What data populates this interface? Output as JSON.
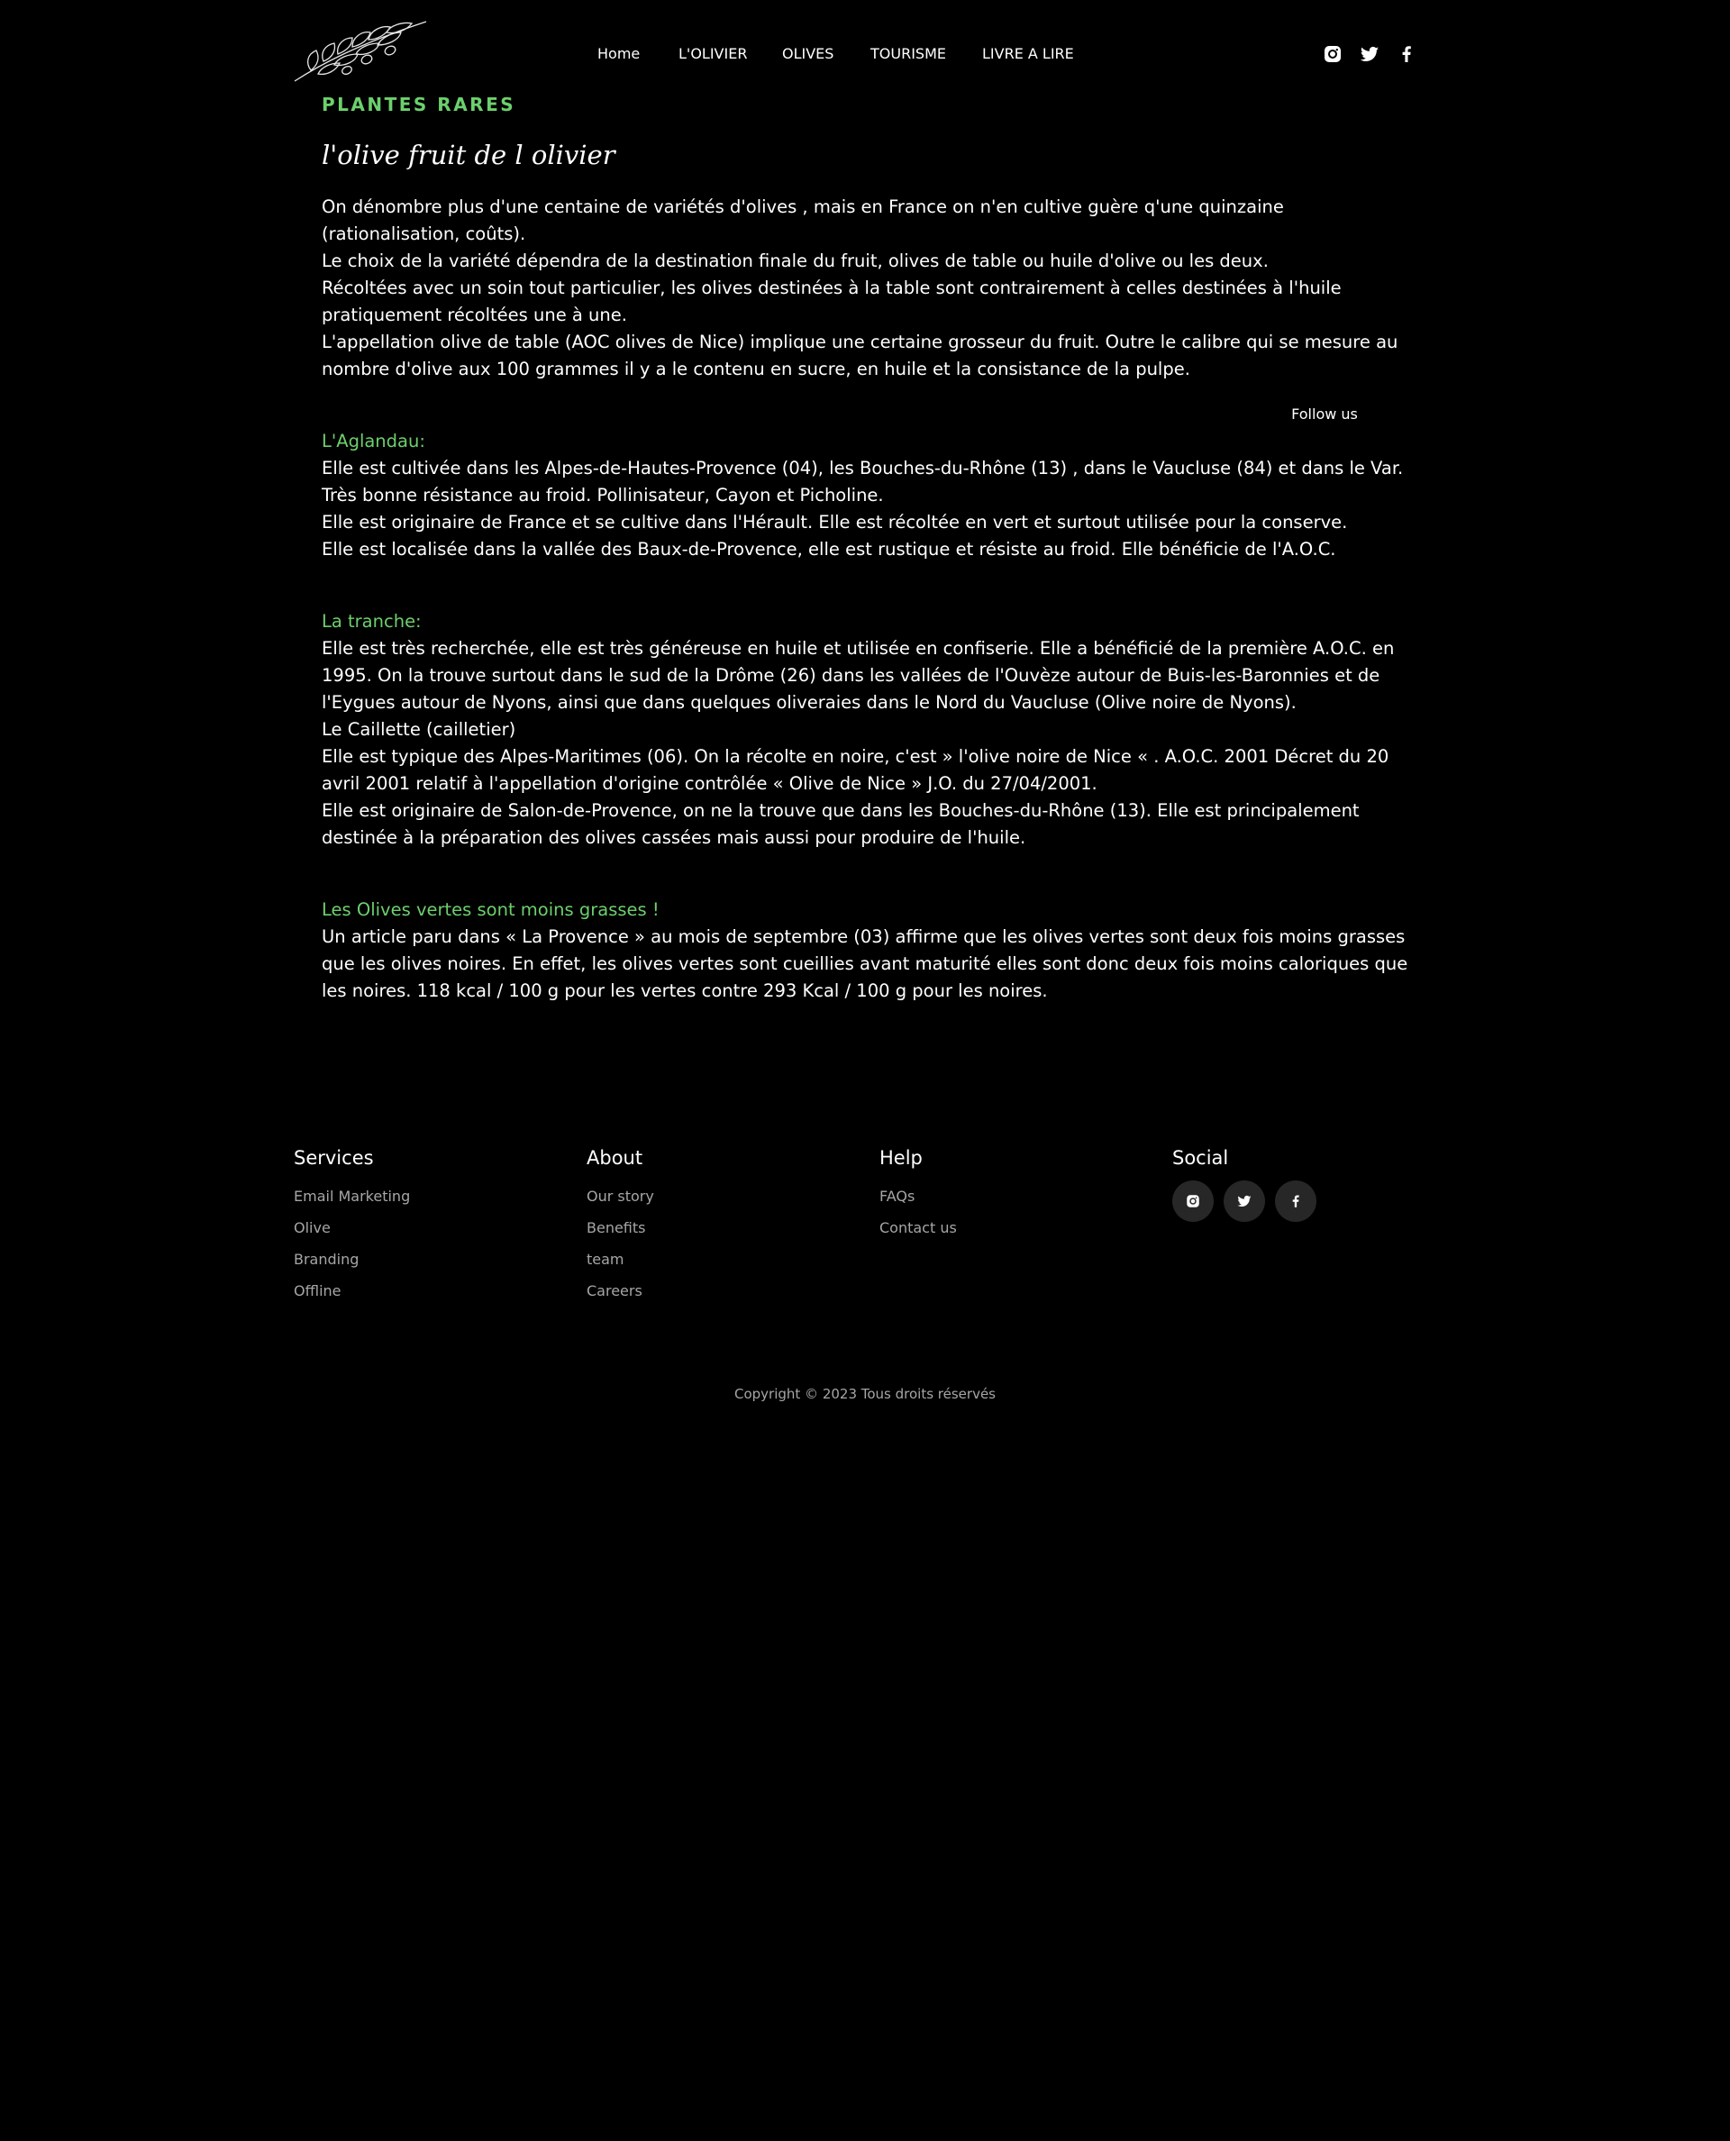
{
  "nav": {
    "items": [
      {
        "label": "Home"
      },
      {
        "label": "L'OLIVIER"
      },
      {
        "label": "OLIVES"
      },
      {
        "label": "TOURISME"
      },
      {
        "label": "LIVRE A LIRE"
      }
    ]
  },
  "header_social": [
    "instagram-icon",
    "twitter-icon",
    "facebook-icon"
  ],
  "page": {
    "kicker": "PLANTES RARES",
    "title": "l'olive fruit de l olivier",
    "intro": [
      "On dénombre plus d'une centaine de variétés d'olives , mais en France on n'en cultive guère q'une quinzaine (rationalisation, coûts).",
      "Le choix de la variété dépendra de la destination finale du fruit, olives de table ou huile d'olive ou les deux.",
      "Récoltées avec un soin tout particulier, les olives destinées à la table sont contrairement à celles destinées à l'huile pratiquement récoltées une à une.",
      "L'appellation olive de table (AOC olives de Nice) implique une certaine grosseur du fruit. Outre le calibre qui se mesure au nombre d'olive aux 100 grammes il y a le contenu en sucre, en huile et la consistance de la pulpe."
    ],
    "follow_us": "Follow us",
    "sections": [
      {
        "heading": "L'Aglandau:",
        "paragraphs": [
          "Elle est cultivée dans les Alpes-de-Hautes-Provence (04), les Bouches-du-Rhône (13) , dans le Vaucluse (84) et dans le Var. Très bonne résistance au froid. Pollinisateur, Cayon et Picholine.",
          "Elle est originaire de France et se cultive dans l'Hérault. Elle est récoltée en vert et surtout utilisée pour la conserve.",
          "Elle est localisée dans la vallée des Baux-de-Provence, elle est rustique et résiste au froid. Elle bénéficie de l'A.O.C."
        ]
      },
      {
        "heading": "La tranche:",
        "paragraphs": [
          "Elle est très recherchée, elle est très généreuse en huile et utilisée en confiserie. Elle a bénéficié de la première A.O.C. en 1995. On la trouve surtout dans le sud de la Drôme (26) dans les vallées de l'Ouvèze autour de Buis-les-Baronnies et de l'Eygues autour de Nyons, ainsi que dans quelques oliveraies dans le Nord du Vaucluse (Olive noire de Nyons).",
          "Le Caillette (cailletier)",
          "Elle est typique des Alpes-Maritimes (06). On la récolte en noire, c'est » l'olive noire de Nice « . A.O.C. 2001 Décret du 20 avril 2001 relatif à l'appellation d'origine contrôlée « Olive de Nice » J.O. du 27/04/2001.",
          "Elle est originaire de Salon-de-Provence, on ne la trouve que dans les Bouches-du-Rhône (13). Elle est principalement destinée à la préparation des olives cassées mais aussi pour produire de l'huile."
        ]
      },
      {
        "heading": "Les Olives vertes sont moins grasses !",
        "paragraphs": [
          "Un article paru dans « La Provence » au mois de septembre (03) affirme que les olives vertes sont deux fois moins grasses que les olives noires. En effet, les olives vertes sont cueillies avant maturité elles sont donc deux fois moins caloriques que les noires. 118 kcal / 100 g pour les vertes contre 293 Kcal / 100 g pour les noires."
        ]
      }
    ]
  },
  "footer": {
    "columns": [
      {
        "title": "Services",
        "links": [
          "Email Marketing",
          "Olive",
          "Branding",
          "Offline"
        ]
      },
      {
        "title": "About",
        "links": [
          "Our story",
          "Benefits",
          "team",
          "Careers"
        ]
      },
      {
        "title": "Help",
        "links": [
          "FAQs",
          "Contact us"
        ]
      },
      {
        "title": "Social",
        "links": []
      }
    ],
    "social_icons": [
      "instagram-icon",
      "twitter-icon",
      "facebook-icon"
    ],
    "copyright": "Copyright © 2023 Tous droits réservés"
  },
  "colors": {
    "background": "#000000",
    "accent_green": "#6cd06c",
    "muted_text": "#a6a6a6",
    "social_circle": "#272727"
  }
}
